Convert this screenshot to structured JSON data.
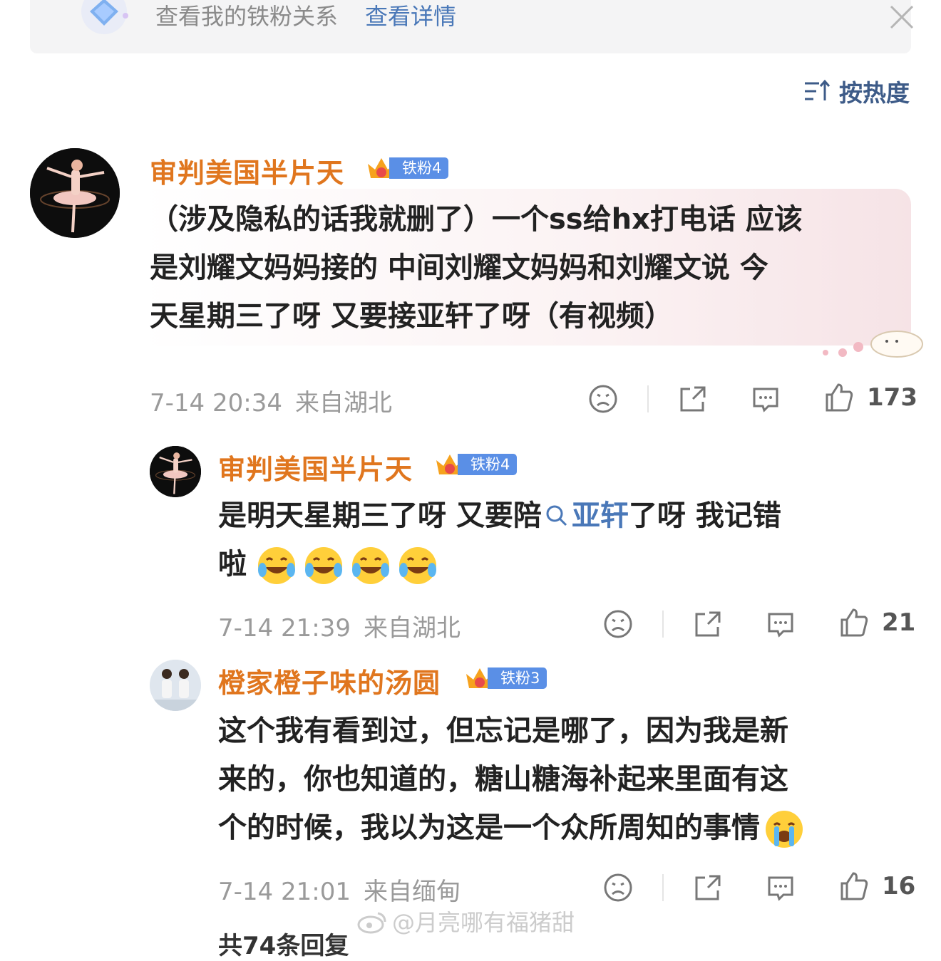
{
  "banner": {
    "text": "查看我的铁粉关系",
    "link": "查看详情"
  },
  "sort": {
    "label": "按热度"
  },
  "comments": [
    {
      "user": "审判美国半片天",
      "badge": "铁粉4",
      "text_lines": [
        "（涉及隐私的话我就删了）一个ss给hx打电话 应该",
        "是刘耀文妈妈接的 中间刘耀文妈妈和刘耀文说 今",
        "天星期三了呀 又要接亚轩了呀（有视频）"
      ],
      "time": "7-14 20:34",
      "location": "来自湖北",
      "likes": "173"
    },
    {
      "user": "审判美国半片天",
      "badge": "铁粉4",
      "text_a": "是明天星期三了呀 又要陪",
      "text_link": "亚轩",
      "text_b": "了呀 我记错",
      "text_c": "啦",
      "time": "7-14 21:39",
      "location": "来自湖北",
      "likes": "21"
    },
    {
      "user": "橙家橙子味的汤圆",
      "badge": "铁粉3",
      "text_lines": [
        "这个我有看到过，但忘记是哪了，因为我是新",
        "来的，你也知道的，糖山糖海补起来里面有这",
        "个的时候，我以为这是一个众所周知的事情"
      ],
      "time": "7-14 21:01",
      "location": "来自缅甸",
      "likes": "16"
    }
  ],
  "watermark": "@月亮哪有福猪甜",
  "footer_partial": "共74条回复"
}
